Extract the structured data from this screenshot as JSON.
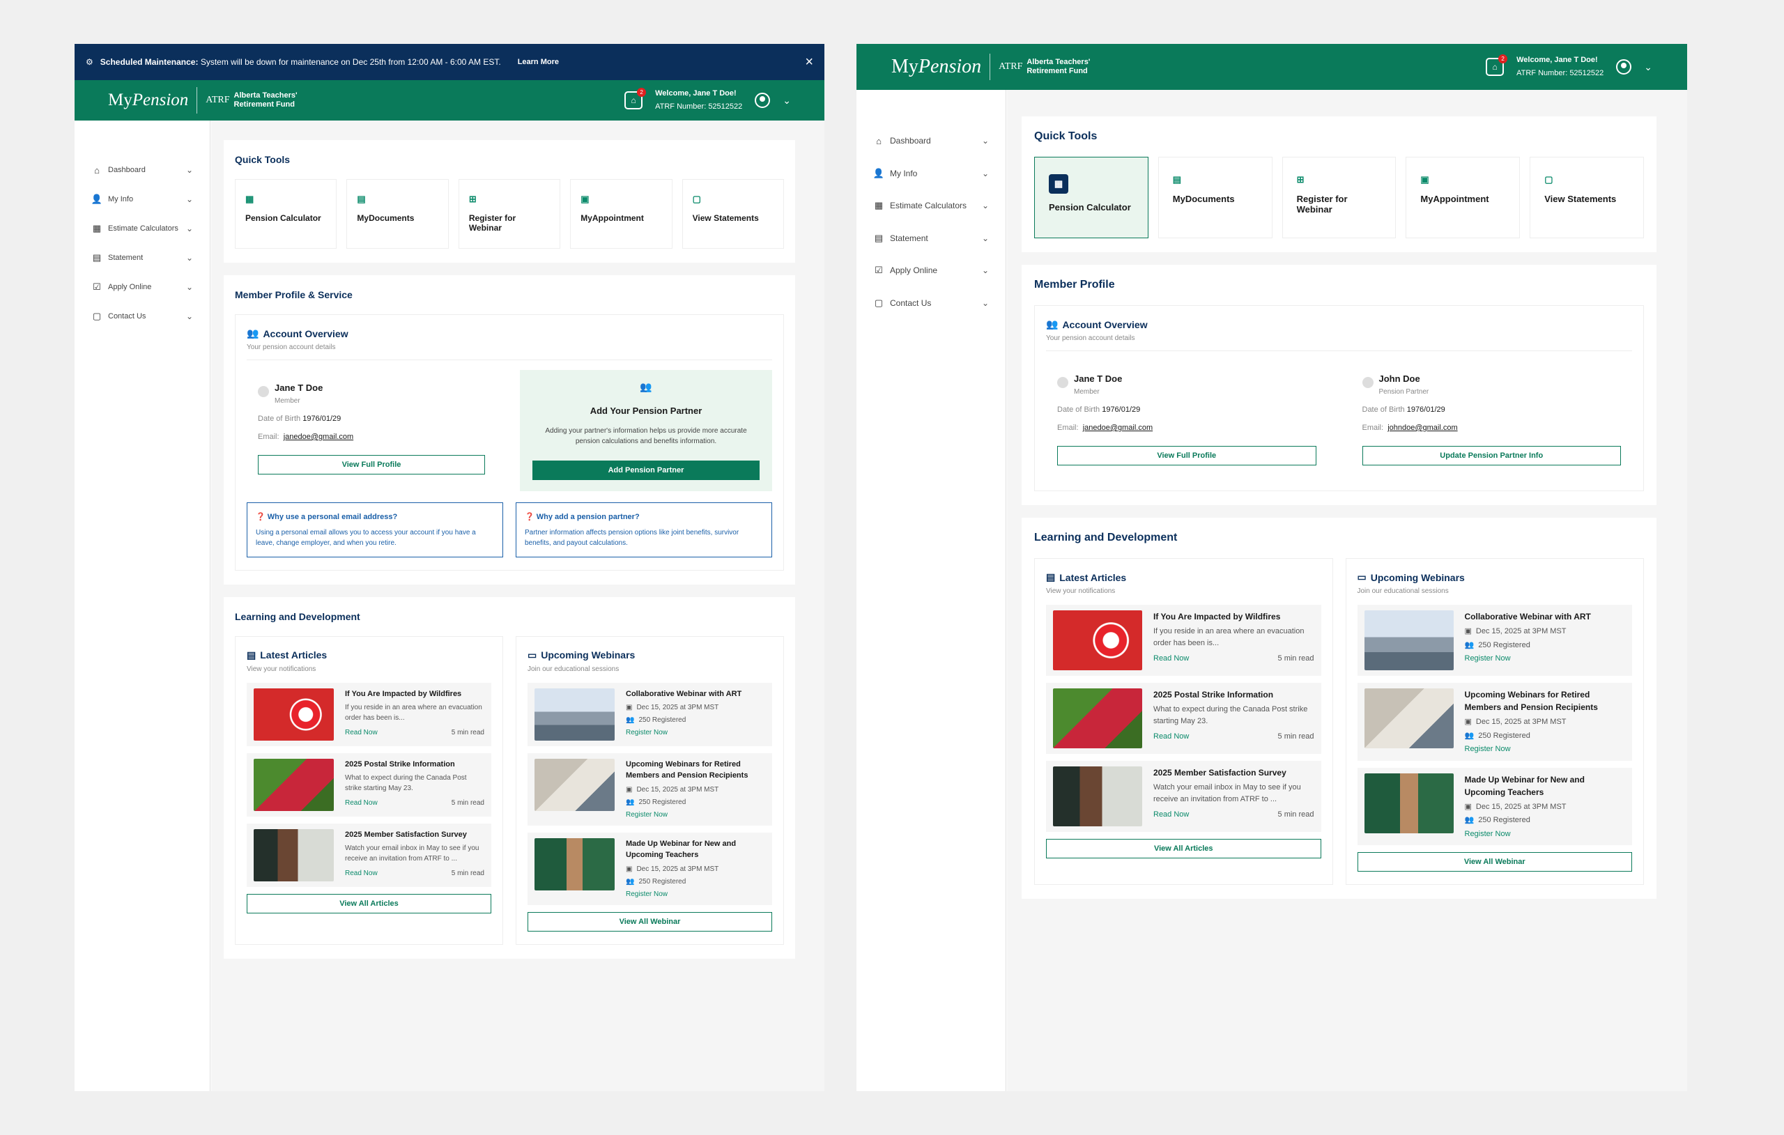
{
  "left": {
    "maintenance": {
      "label": "Scheduled Maintenance:",
      "text": "System will be down for maintenance on Dec 25th from 12:00 AM - 6:00 AM EST.",
      "link": "Learn More",
      "close": "×"
    },
    "header": {
      "logo_my": "My",
      "logo_pension": "Pension",
      "atrf": "ATRF",
      "fund1": "Alberta Teachers'",
      "fund2": "Retirement Fund",
      "notif_count": "2",
      "welcome": "Welcome, Jane T Doe!",
      "member": "ATRF Number: 52512522"
    },
    "nav": [
      {
        "icon": "home-icon",
        "label": "Dashboard"
      },
      {
        "icon": "user-settings-icon",
        "label": "My Info"
      },
      {
        "icon": "calculator-icon",
        "label": "Estimate Calculators"
      },
      {
        "icon": "statement-icon",
        "label": "Statement"
      },
      {
        "icon": "calendar-check-icon",
        "label": "Apply Online"
      },
      {
        "icon": "chat-icon",
        "label": "Contact Us"
      }
    ],
    "quick_tools": {
      "title": "Quick Tools",
      "tools": [
        "Pension Calculator",
        "MyDocuments",
        "Register for Webinar",
        "MyAppointment",
        "View Statements"
      ]
    },
    "profile": {
      "title": "Member Profile & Service",
      "overview": "Account Overview",
      "overview_sub": "Your pension account details",
      "member": {
        "name": "Jane T Doe",
        "role": "Member",
        "dob_label": "Date of Birth",
        "dob": "1976/01/29",
        "email_label": "Email:",
        "email": "janedoe@gmail.com",
        "button": "View Full Profile"
      },
      "partner": {
        "title": "Add Your Pension Partner",
        "desc": "Adding your partner's information helps us provide more accurate pension calculations and benefits information.",
        "button": "Add Pension Partner"
      },
      "faq": [
        {
          "q": "Why use a personal email address?",
          "a": "Using a personal email allows you to access your account if you have a leave, change employer, and when you retire."
        },
        {
          "q": "Why add a pension partner?",
          "a": "Partner information affects pension options like joint benefits, survivor benefits, and payout calculations."
        }
      ]
    },
    "learning": {
      "title": "Learning and Development",
      "articles": {
        "title": "Latest Articles",
        "sub": "View your notifications",
        "button": "View All Articles",
        "items": [
          {
            "title": "If You Are Impacted by Wildfires",
            "desc": "If you reside in an area where an evacuation order has been is...",
            "link": "Read Now",
            "time": "5 min read"
          },
          {
            "title": "2025 Postal Strike Information",
            "desc": "What to expect during the Canada Post strike starting May 23.",
            "link": "Read Now",
            "time": "5 min read"
          },
          {
            "title": "2025 Member Satisfaction Survey",
            "desc": "Watch your email inbox in May to see if you receive an invitation from ATRF to ...",
            "link": "Read Now",
            "time": "5 min read"
          }
        ]
      },
      "webinars": {
        "title": "Upcoming Webinars",
        "sub": "Join our educational sessions",
        "button": "View All Webinar",
        "items": [
          {
            "title": "Collaborative Webinar with ART",
            "date": "Dec 15, 2025 at 3PM MST",
            "reg": "250 Registered",
            "link": "Register Now"
          },
          {
            "title": "Upcoming Webinars for Retired Members and Pension Recipients",
            "date": "Dec 15, 2025 at 3PM MST",
            "reg": "250 Registered",
            "link": "Register Now"
          },
          {
            "title": "Made Up Webinar for  New and Upcoming Teachers",
            "date": "Dec 15, 2025 at 3PM MST",
            "reg": "250 Registered",
            "link": "Register Now"
          }
        ]
      }
    }
  },
  "right": {
    "header": {
      "logo_my": "My",
      "logo_pension": "Pension",
      "atrf": "ATRF",
      "fund1": "Alberta Teachers'",
      "fund2": "Retirement Fund",
      "notif_count": "2",
      "welcome": "Welcome, Jane T Doe!",
      "member": "ATRF Number: 52512522"
    },
    "nav": [
      {
        "icon": "home-icon",
        "label": "Dashboard"
      },
      {
        "icon": "user-settings-icon",
        "label": "My Info"
      },
      {
        "icon": "calculator-icon",
        "label": "Estimate Calculators"
      },
      {
        "icon": "statement-icon",
        "label": "Statement"
      },
      {
        "icon": "calendar-check-icon",
        "label": "Apply Online"
      },
      {
        "icon": "chat-icon",
        "label": "Contact Us"
      }
    ],
    "quick_tools": {
      "title": "Quick Tools",
      "tools": [
        "Pension Calculator",
        "MyDocuments",
        "Register for Webinar",
        "MyAppointment",
        "View Statements"
      ]
    },
    "profile": {
      "title": "Member Profile",
      "overview": "Account Overview",
      "overview_sub": "Your pension account details",
      "member": {
        "name": "Jane T Doe",
        "role": "Member",
        "dob_label": "Date of Birth",
        "dob": "1976/01/29",
        "email_label": "Email:",
        "email": "janedoe@gmail.com",
        "button": "View Full Profile"
      },
      "partner": {
        "name": "John Doe",
        "role": "Pension Partner",
        "dob_label": "Date of Birth",
        "dob": "1976/01/29",
        "email_label": "Email:",
        "email": "johndoe@gmail.com",
        "button": "Update Pension Partner Info"
      }
    },
    "learning": {
      "title": "Learning and Development",
      "articles": {
        "title": "Latest Articles",
        "sub": "View your notifications",
        "button": "View All Articles",
        "items": [
          {
            "title": "If You Are Impacted by Wildfires",
            "desc": "If you reside in an area where an evacuation order has been is...",
            "link": "Read Now",
            "time": "5 min read"
          },
          {
            "title": "2025 Postal Strike Information",
            "desc": "What to expect during the Canada Post strike starting May 23.",
            "link": "Read Now",
            "time": "5 min read"
          },
          {
            "title": "2025 Member Satisfaction Survey",
            "desc": "Watch your email inbox in May to see if you receive an invitation from ATRF to ...",
            "link": "Read Now",
            "time": "5 min read"
          }
        ]
      },
      "webinars": {
        "title": "Upcoming Webinars",
        "sub": "Join our educational sessions",
        "button": "View All Webinar",
        "items": [
          {
            "title": "Collaborative Webinar with ART",
            "date": "Dec 15, 2025 at 3PM MST",
            "reg": "250 Registered",
            "link": "Register Now"
          },
          {
            "title": "Upcoming Webinars for Retired Members and Pension Recipients",
            "date": "Dec 15, 2025 at 3PM MST",
            "reg": "250 Registered",
            "link": "Register Now"
          },
          {
            "title": "Made Up Webinar for  New and Upcoming Teachers",
            "date": "Dec 15, 2025 at 3PM MST",
            "reg": "250 Registered",
            "link": "Register Now"
          }
        ]
      }
    }
  },
  "colors": {
    "brand_green": "#0a7a5a",
    "navy": "#0b2f5b",
    "maintenance_bg": "#0b2f5b",
    "partner_bg": "#eaf5ee",
    "link_blue": "#1a5fa8"
  }
}
